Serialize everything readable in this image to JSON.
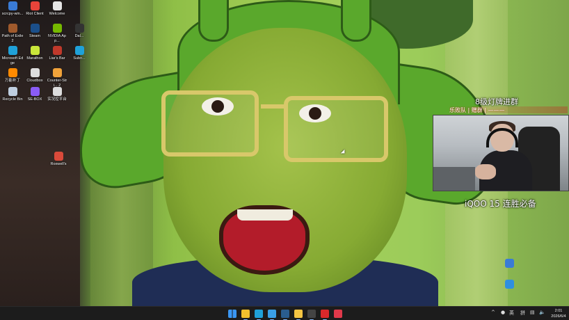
{
  "desktop": {
    "icons": [
      {
        "label": "scrcpy-win...",
        "color": "#3a7bd5"
      },
      {
        "label": "Riot Client",
        "color": "#e8443a"
      },
      {
        "label": "Welcome",
        "color": "#e6e6e6"
      },
      {
        "label": "Path of Exile 2",
        "color": "#a05a2c"
      },
      {
        "label": "Steam",
        "color": "#1b4f8a"
      },
      {
        "label": "NVIDIA App...",
        "color": "#76b900"
      },
      {
        "label": "Microsoft Edge",
        "color": "#1fa1d9"
      },
      {
        "label": "Marathon",
        "color": "#c9e63a"
      },
      {
        "label": "Liar's Bar",
        "color": "#c0392b"
      },
      {
        "label": "万能补丁",
        "color": "#ff8a00"
      },
      {
        "label": "Cloudbox",
        "color": "#dddddd"
      },
      {
        "label": "Counter-Stri...\n2",
        "color": "#f2a33a"
      },
      {
        "label": "Recycle Bin",
        "color": "#bfcfe0"
      },
      {
        "label": "SE-BOX",
        "color": "#8a5cf6"
      },
      {
        "label": "实况控平台",
        "color": "#dddddd"
      },
      {
        "label": "Roxwell's",
        "color": "#d94a3a"
      },
      {
        "label": "Dal...",
        "color": "#333333"
      },
      {
        "label": "Subn...",
        "color": "#1fa1d9"
      }
    ],
    "right_icons": [
      {
        "label": "",
        "color": "#3a7bd5"
      },
      {
        "label": "",
        "color": "#2f8fe0"
      }
    ]
  },
  "stream_overlay": {
    "caption_top": "8级灯牌进群",
    "scroll_text": "乐败队 | 赠群 | ———",
    "caption_bottom": "iQOO 15 连胜必备"
  },
  "taskbar": {
    "apps": [
      {
        "name": "start-button",
        "color": "#3a96f2"
      },
      {
        "name": "file-explorer-icon",
        "color": "#f2c12e"
      },
      {
        "name": "edge-icon",
        "color": "#1fa1d9"
      },
      {
        "name": "app-blue-icon",
        "color": "#3aa0e6"
      },
      {
        "name": "steam-icon",
        "color": "#2a5d8f"
      },
      {
        "name": "app-yellow-icon",
        "color": "#f5c542"
      },
      {
        "name": "obs-icon",
        "color": "#444444"
      },
      {
        "name": "app-red-icon",
        "color": "#d9282b"
      },
      {
        "name": "app-pink-icon",
        "color": "#e0394a"
      }
    ],
    "tray": {
      "chevron": "^",
      "lang": "英",
      "ime": "拼"
    },
    "clock": {
      "time": "2:01",
      "date": "2026/6/4"
    }
  }
}
